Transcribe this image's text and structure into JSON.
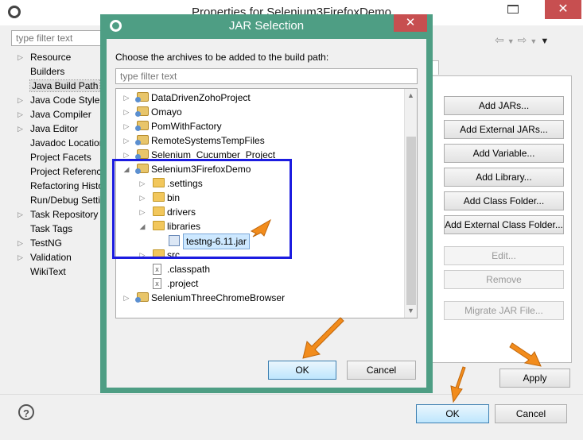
{
  "window": {
    "title": "Properties for Selenium3FirefoxDemo",
    "filter_placeholder": "type filter text",
    "close_glyph": "✕"
  },
  "nav_tree": [
    {
      "label": "Resource",
      "expandable": true
    },
    {
      "label": "Builders",
      "expandable": false
    },
    {
      "label": "Java Build Path",
      "expandable": false,
      "selected": true
    },
    {
      "label": "Java Code Style",
      "expandable": true
    },
    {
      "label": "Java Compiler",
      "expandable": true
    },
    {
      "label": "Java Editor",
      "expandable": true
    },
    {
      "label": "Javadoc Location",
      "expandable": false
    },
    {
      "label": "Project Facets",
      "expandable": false
    },
    {
      "label": "Project References",
      "expandable": false
    },
    {
      "label": "Refactoring History",
      "expandable": false
    },
    {
      "label": "Run/Debug Settings",
      "expandable": false
    },
    {
      "label": "Task Repository",
      "expandable": true
    },
    {
      "label": "Task Tags",
      "expandable": false
    },
    {
      "label": "TestNG",
      "expandable": true
    },
    {
      "label": "Validation",
      "expandable": true
    },
    {
      "label": "WikiText",
      "expandable": false
    }
  ],
  "build_path_buttons": {
    "add_jars": "Add JARs...",
    "add_external_jars": "Add External JARs...",
    "add_variable": "Add Variable...",
    "add_library": "Add Library...",
    "add_class_folder": "Add Class Folder...",
    "add_external_class_folder": "Add External Class Folder...",
    "edit": "Edit...",
    "remove": "Remove",
    "migrate_jar": "Migrate JAR File..."
  },
  "tab_fragment": "t",
  "footer": {
    "apply": "Apply",
    "ok": "OK",
    "cancel": "Cancel",
    "help": "?"
  },
  "dialog": {
    "title": "JAR Selection",
    "instruction": "Choose the archives to be added to the build path:",
    "filter_placeholder": "type filter text",
    "ok": "OK",
    "cancel": "Cancel",
    "close_glyph": "✕",
    "tree": [
      {
        "label": "DataDrivenZohoProject",
        "level": 0,
        "kind": "project",
        "expander": "▷"
      },
      {
        "label": "Omayo",
        "level": 0,
        "kind": "project",
        "expander": "▷"
      },
      {
        "label": "PomWithFactory",
        "level": 0,
        "kind": "project",
        "expander": "▷"
      },
      {
        "label": "RemoteSystemsTempFiles",
        "level": 0,
        "kind": "project",
        "expander": "▷"
      },
      {
        "label": "Selenium_Cucumber_Project",
        "level": 0,
        "kind": "project",
        "expander": "▷"
      },
      {
        "label": "Selenium3FirefoxDemo",
        "level": 0,
        "kind": "project",
        "expander": "◢"
      },
      {
        "label": ".settings",
        "level": 1,
        "kind": "folder",
        "expander": "▷"
      },
      {
        "label": "bin",
        "level": 1,
        "kind": "folder",
        "expander": "▷"
      },
      {
        "label": "drivers",
        "level": 1,
        "kind": "folder",
        "expander": "▷"
      },
      {
        "label": "libraries",
        "level": 1,
        "kind": "folder",
        "expander": "◢"
      },
      {
        "label": "testng-6.11.jar",
        "level": 2,
        "kind": "jar",
        "expander": "",
        "selected": true
      },
      {
        "label": "src",
        "level": 1,
        "kind": "folder",
        "expander": "▷"
      },
      {
        "label": ".classpath",
        "level": 1,
        "kind": "file",
        "expander": ""
      },
      {
        "label": ".project",
        "level": 1,
        "kind": "file",
        "expander": ""
      },
      {
        "label": "SeleniumThreeChromeBrowser",
        "level": 0,
        "kind": "project",
        "expander": "▷"
      }
    ]
  },
  "colors": {
    "dialog_frame": "#4e9e84",
    "highlight_box": "#1c1ce0",
    "arrow": "#f28c1c",
    "close_button": "#c74f50"
  }
}
